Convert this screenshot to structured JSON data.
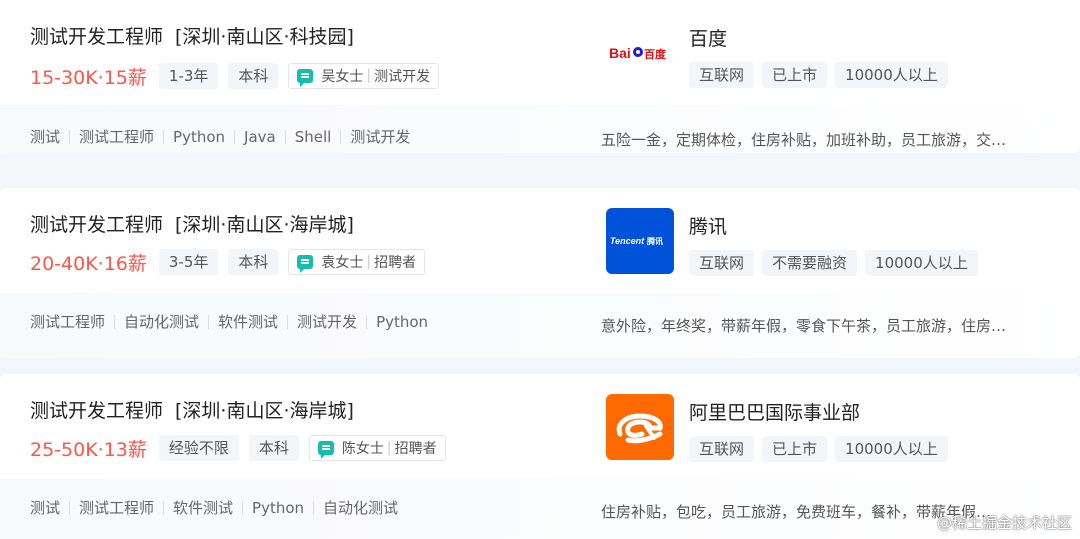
{
  "jobs": [
    {
      "title": "测试开发工程师",
      "location": "[深圳·南山区·科技园]",
      "salary": "15-30K·15薪",
      "experience": "1-3年",
      "education": "本科",
      "recruiter_name": "吴女士",
      "recruiter_role": "测试开发",
      "skills": [
        "测试",
        "测试工程师",
        "Python",
        "Java",
        "Shell",
        "测试开发"
      ],
      "company": {
        "name": "百度",
        "logo": "baidu-logo",
        "industry": "互联网",
        "funding": "已上市",
        "size": "10000人以上"
      },
      "benefits": "五险一金，定期体检，住房补贴，加班补助，员工旅游，交…"
    },
    {
      "title": "测试开发工程师",
      "location": "[深圳·南山区·海岸城]",
      "salary": "20-40K·16薪",
      "experience": "3-5年",
      "education": "本科",
      "recruiter_name": "袁女士",
      "recruiter_role": "招聘者",
      "skills": [
        "测试工程师",
        "自动化测试",
        "软件测试",
        "测试开发",
        "Python"
      ],
      "company": {
        "name": "腾讯",
        "logo": "tencent-logo",
        "industry": "互联网",
        "funding": "不需要融资",
        "size": "10000人以上"
      },
      "benefits": "意外险，年终奖，带薪年假，零食下午茶，员工旅游，住房…"
    },
    {
      "title": "测试开发工程师",
      "location": "[深圳·南山区·海岸城]",
      "salary": "25-50K·13薪",
      "experience": "经验不限",
      "education": "本科",
      "recruiter_name": "陈女士",
      "recruiter_role": "招聘者",
      "skills": [
        "测试",
        "测试工程师",
        "软件测试",
        "Python",
        "自动化测试"
      ],
      "company": {
        "name": "阿里巴巴国际事业部",
        "logo": "alibaba-logo",
        "industry": "互联网",
        "funding": "已上市",
        "size": "10000人以上"
      },
      "benefits": "住房补贴，包吃，员工旅游，免费班车，餐补，带薪年假…"
    }
  ],
  "logo_text": {
    "baidu": "Bai百度",
    "tencent": "Tencent腾讯"
  },
  "watermark": "@稀土掘金技术社区",
  "colors": {
    "salary": "#fe574a",
    "chat_icon": "#12bfaf",
    "tencent_blue": "#0052d9",
    "alibaba_orange": "#ff6a00",
    "baidu_red": "#de0f17",
    "baidu_blue": "#2319dc"
  }
}
